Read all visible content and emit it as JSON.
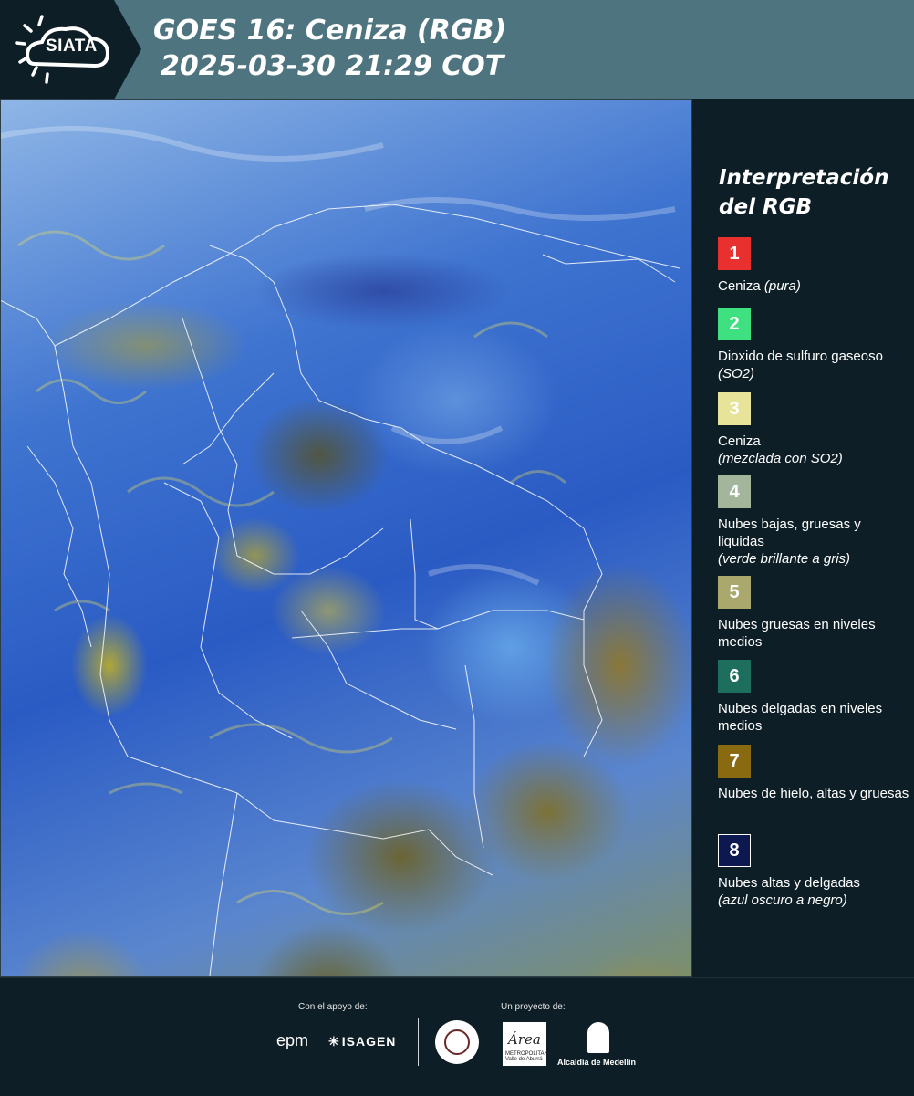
{
  "header": {
    "logo_text": "SIATA",
    "title_line1": "GOES 16: Ceniza (RGB)",
    "title_line2": "2025-03-30 21:29 COT"
  },
  "legend": {
    "title": "Interpretación del RGB",
    "items": [
      {
        "num": "1",
        "color": "#e8302f",
        "label": "Ceniza",
        "note": "(pura)"
      },
      {
        "num": "2",
        "color": "#3fe080",
        "label": "Dioxido de sulfuro gaseoso",
        "note": "(SO2)"
      },
      {
        "num": "3",
        "color": "#e7e49a",
        "label": "Ceniza",
        "note": "(mezclada con SO2)"
      },
      {
        "num": "4",
        "color": "#a3b59b",
        "label": "Nubes bajas, gruesas y liquidas",
        "note": "(verde brillante a gris)"
      },
      {
        "num": "5",
        "color": "#aaa86c",
        "label": "Nubes gruesas en niveles medios",
        "note": ""
      },
      {
        "num": "6",
        "color": "#1e6e5e",
        "label": "Nubes delgadas en niveles medios",
        "note": ""
      },
      {
        "num": "7",
        "color": "#8a6a10",
        "label": "Nubes de hielo, altas y gruesas",
        "note": ""
      },
      {
        "num": "8",
        "color": "#0e1850",
        "label": "Nubes altas y delgadas",
        "note": "(azul oscuro a negro)"
      }
    ]
  },
  "footer": {
    "support_label": "Con el apoyo de:",
    "project_label": "Un proyecto de:",
    "sponsor1": "epm",
    "sponsor2": "ISAGEN",
    "partner1_text": "Área",
    "partner1_sub": "METROPOLITANA Valle de Aburrá",
    "partner2": "Alcaldía de Medellín"
  },
  "map": {
    "description_icon": "satellite-rgb-ash-image"
  }
}
